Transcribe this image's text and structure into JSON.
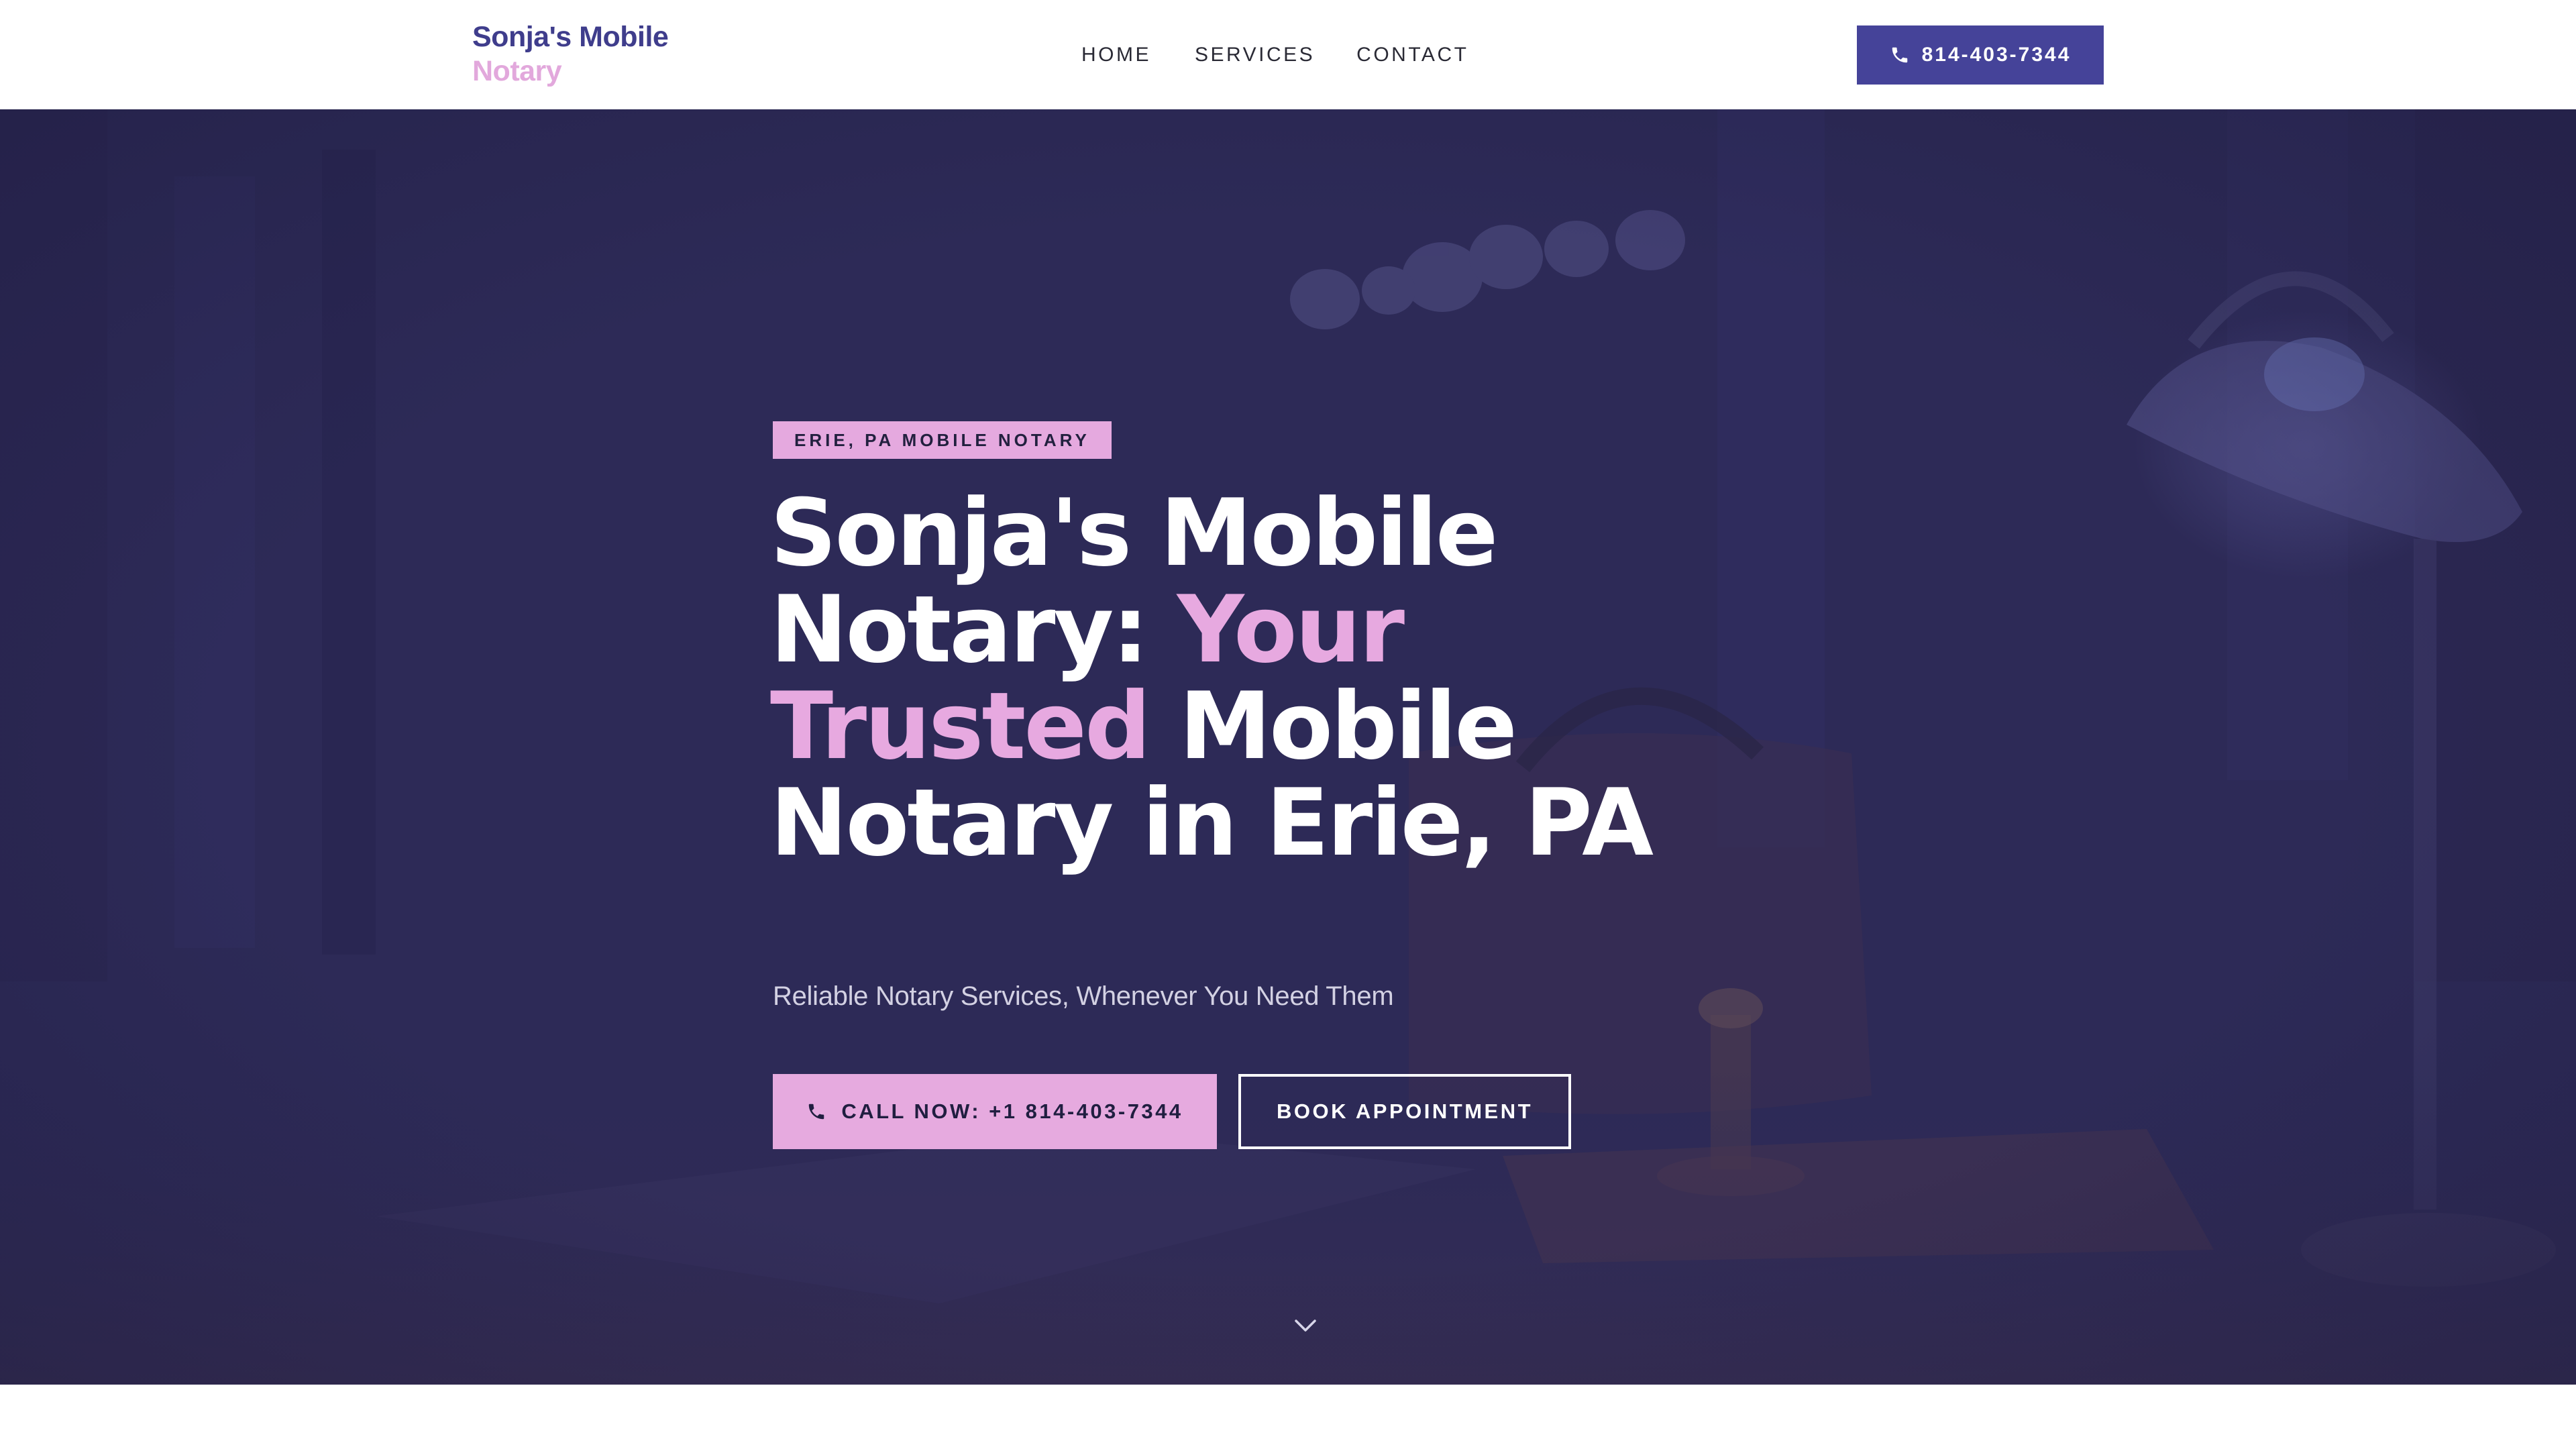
{
  "header": {
    "logo_line1": "Sonja's Mobile",
    "logo_line2": "Notary",
    "nav": {
      "home": "HOME",
      "services": "SERVICES",
      "contact": "CONTACT"
    },
    "phone_button": "814-403-7344"
  },
  "hero": {
    "badge": "ERIE, PA MOBILE NOTARY",
    "headline": {
      "part1": "Sonja's Mobile",
      "part2": "Notary: ",
      "part3": "Your",
      "part4": "Trusted",
      "part5": " Mobile",
      "part6": "Notary in Erie, PA"
    },
    "subheadline": "Reliable Notary Services, Whenever You Need Them",
    "call_button": "CALL NOW: +1 814-403-7344",
    "book_button": "BOOK APPOINTMENT"
  },
  "icons": {
    "phone": "phone-icon",
    "scroll": "chevron-down-icon"
  },
  "colors": {
    "brand_indigo": "#454399",
    "brand_pink": "#e6aadf",
    "hero_overlay": "#2d2a57",
    "logo_text": "#3f3d8c"
  }
}
